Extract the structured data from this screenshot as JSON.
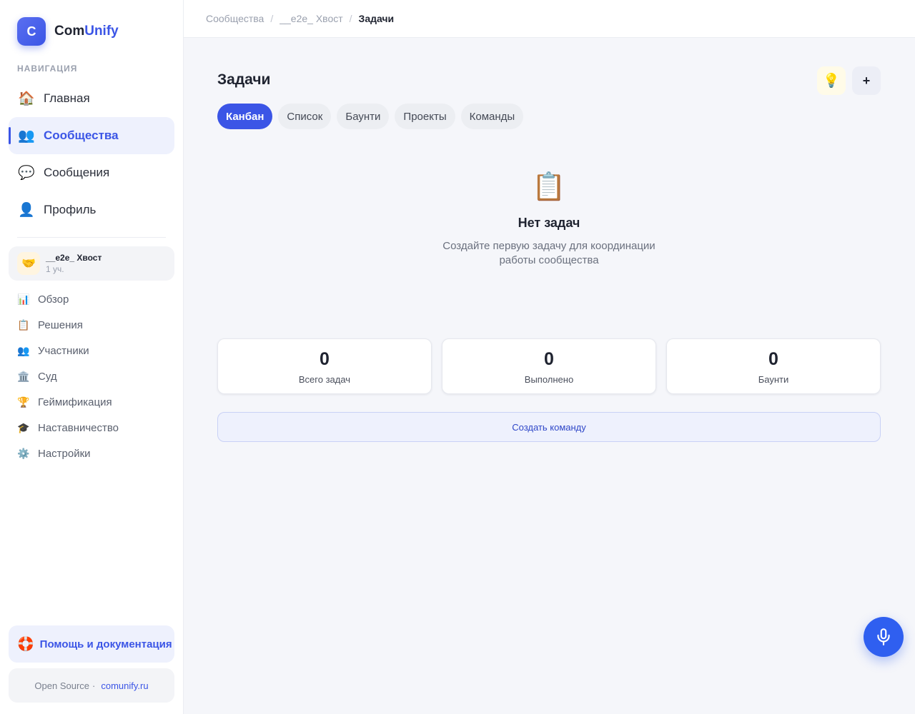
{
  "brand": {
    "logo_letter": "C",
    "name_part1": "Com",
    "name_part2": "Unify",
    "accent": "#3b55e6"
  },
  "nav": {
    "heading": "НАВИГАЦИЯ",
    "items": [
      {
        "icon": "🏠",
        "label": "Главная",
        "active": false
      },
      {
        "icon": "👥",
        "label": "Сообщества",
        "active": true
      },
      {
        "icon": "💬",
        "label": "Сообщения",
        "active": false
      },
      {
        "icon": "👤",
        "label": "Профиль",
        "active": false
      }
    ]
  },
  "community": {
    "avatar": "🤝",
    "name": "__e2e_ Хвост",
    "meta": "1 уч."
  },
  "community_nav": [
    {
      "icon": "📊",
      "label": "Обзор"
    },
    {
      "icon": "📋",
      "label": "Решения"
    },
    {
      "icon": "👥",
      "label": "Участники"
    },
    {
      "icon": "🏛️",
      "label": "Суд"
    },
    {
      "icon": "🏆",
      "label": "Геймификация"
    },
    {
      "icon": "🎓",
      "label": "Наставничество"
    },
    {
      "icon": "⚙️",
      "label": "Настройки"
    }
  ],
  "help": {
    "icon": "🛟",
    "label": "Помощь и документация"
  },
  "footer": {
    "text": "Open Source",
    "separator": "·",
    "link": "comunify.ru"
  },
  "breadcrumb": {
    "items": [
      "Сообщества",
      "__e2e_ Хвост"
    ],
    "current": "Задачи",
    "separator": "/"
  },
  "page": {
    "title": "Задачи",
    "hint_icon": "💡",
    "add_label": "+",
    "tabs": [
      {
        "label": "Канбан",
        "active": true
      },
      {
        "label": "Список",
        "active": false
      },
      {
        "label": "Баунти",
        "active": false
      },
      {
        "label": "Проекты",
        "active": false
      },
      {
        "label": "Команды",
        "active": false
      }
    ]
  },
  "empty_state": {
    "icon": "📋",
    "title": "Нет задач",
    "description": "Создайте первую задачу для координации работы сообщества"
  },
  "stats": [
    {
      "value": "0",
      "label": "Всего задач"
    },
    {
      "value": "0",
      "label": "Выполнено"
    },
    {
      "value": "0",
      "label": "Баунти"
    }
  ],
  "create_team_label": "Создать команду",
  "colors": {
    "primary": "#3b55e6",
    "mic": "#2f5ff0"
  }
}
